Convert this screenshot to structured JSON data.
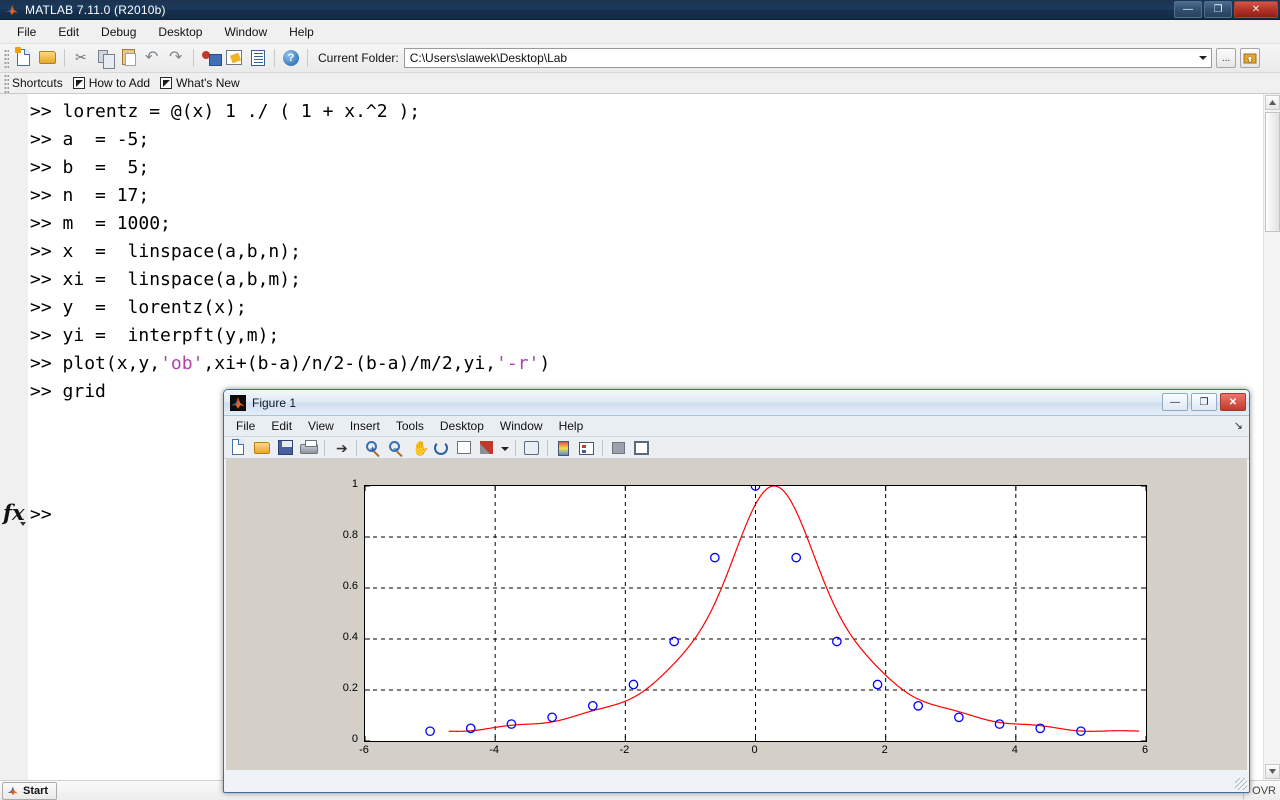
{
  "app": {
    "title": "MATLAB  7.11.0 (R2010b)",
    "logo_icon": "matlab-logo-icon"
  },
  "window_controls": {
    "minimize": "—",
    "maximize": "❐",
    "close": "✕"
  },
  "menu": {
    "items": [
      "File",
      "Edit",
      "Debug",
      "Desktop",
      "Window",
      "Help"
    ]
  },
  "toolbar": {
    "icons": [
      "new-script-icon",
      "open-file-icon",
      "cut-icon",
      "copy-icon",
      "paste-icon",
      "undo-icon",
      "redo-icon",
      "simulink-icon",
      "guide-icon",
      "profiler-icon",
      "help-icon"
    ],
    "current_folder_label": "Current Folder:",
    "current_folder_value": "C:\\Users\\slawek\\Desktop\\Lab",
    "browse_button_label": "...",
    "up_folder_icon": "folder-up-icon"
  },
  "shortcuts_bar": {
    "shortcuts_label": "Shortcuts",
    "how_to_add_label": "How to Add",
    "whats_new_label": "What's New"
  },
  "command_window": {
    "lines": [
      {
        "prompt": ">> ",
        "segments": [
          {
            "text": "lorentz = @(x) 1 ./ ( 1 + x.^2 );",
            "kind": "plain"
          }
        ]
      },
      {
        "prompt": ">> ",
        "segments": [
          {
            "text": "a  = -5;",
            "kind": "plain"
          }
        ]
      },
      {
        "prompt": ">> ",
        "segments": [
          {
            "text": "b  =  5;",
            "kind": "plain"
          }
        ]
      },
      {
        "prompt": ">> ",
        "segments": [
          {
            "text": "n  = 17;",
            "kind": "plain"
          }
        ]
      },
      {
        "prompt": ">> ",
        "segments": [
          {
            "text": "m  = 1000;",
            "kind": "plain"
          }
        ]
      },
      {
        "prompt": ">> ",
        "segments": [
          {
            "text": "x  =  linspace(a,b,n);",
            "kind": "plain"
          }
        ]
      },
      {
        "prompt": ">> ",
        "segments": [
          {
            "text": "xi =  linspace(a,b,m);",
            "kind": "plain"
          }
        ]
      },
      {
        "prompt": ">> ",
        "segments": [
          {
            "text": "y  =  lorentz(x);",
            "kind": "plain"
          }
        ]
      },
      {
        "prompt": ">> ",
        "segments": [
          {
            "text": "yi =  interpft(y,m);",
            "kind": "plain"
          }
        ]
      },
      {
        "prompt": ">> ",
        "segments": [
          {
            "text": "plot(x,y,",
            "kind": "plain"
          },
          {
            "text": "'ob'",
            "kind": "string"
          },
          {
            "text": ",xi+(b-a)/n/2-(b-a)/m/2,yi,",
            "kind": "plain"
          },
          {
            "text": "'-r'",
            "kind": "string"
          },
          {
            "text": ")",
            "kind": "plain"
          }
        ]
      },
      {
        "prompt": ">> ",
        "segments": [
          {
            "text": "grid",
            "kind": "plain"
          }
        ]
      }
    ],
    "active_prompt": ">>",
    "fx_label": "fx"
  },
  "status_bar": {
    "start_label": "Start",
    "start_icon": "matlab-logo-icon",
    "overwrite_label": "OVR"
  },
  "figure": {
    "title": "Figure 1",
    "logo_icon": "matlab-logo-icon",
    "window_controls": {
      "minimize": "—",
      "maximize": "❐",
      "close": "✕"
    },
    "menu": {
      "items": [
        "File",
        "Edit",
        "View",
        "Insert",
        "Tools",
        "Desktop",
        "Window",
        "Help"
      ]
    },
    "menu_expand_icon": "expand-arrow-icon",
    "toolbar_icons": [
      "new-figure-icon",
      "open-figure-icon",
      "save-figure-icon",
      "print-figure-icon",
      "pointer-icon",
      "zoom-in-icon",
      "zoom-out-icon",
      "pan-icon",
      "rotate-3d-icon",
      "data-cursor-icon",
      "brush-icon",
      "brush-dropdown-icon",
      "link-plot-icon",
      "colorbar-icon",
      "legend-icon",
      "hide-plot-tools-icon",
      "show-plot-tools-icon"
    ]
  },
  "chart_data": {
    "type": "scatter",
    "title": "",
    "xlabel": "",
    "ylabel": "",
    "xlim": [
      -6,
      6
    ],
    "ylim": [
      0,
      1
    ],
    "xticks": [
      -6,
      -4,
      -2,
      0,
      2,
      4,
      6
    ],
    "yticks": [
      0,
      0.2,
      0.4,
      0.6,
      0.8,
      1
    ],
    "grid": true,
    "legend": "none",
    "colors": {
      "markers": "#0000ff",
      "line": "#ff0000",
      "axes": "#000000",
      "figure_bg": "#d4d0c8",
      "axes_bg": "#ffffff"
    },
    "series": [
      {
        "name": "sample points (x, y) marker 'ob'",
        "style": "markers",
        "marker": "circle-open",
        "color": "#0000ff",
        "x": [
          -5,
          -4.375,
          -3.75,
          -3.125,
          -2.5,
          -1.875,
          -1.25,
          -0.625,
          0,
          0.625,
          1.25,
          1.875,
          2.5,
          3.125,
          3.75,
          4.375,
          5
        ],
        "y": [
          0.0385,
          0.0496,
          0.0664,
          0.0929,
          0.1379,
          0.2215,
          0.3902,
          0.7191,
          1.0,
          0.7191,
          0.3902,
          0.2215,
          0.1379,
          0.0929,
          0.0664,
          0.0496,
          0.0385
        ]
      },
      {
        "name": "interpft interpolation (xi shifted, yi) line '-r'",
        "style": "line",
        "color": "#ff0000",
        "x_range": [
          -4.7,
          5.3
        ],
        "description": "Fourier interpolation of the Lorentzian 1/(1+x^2) sampled at 17 points, evaluated at 1000 points shifted by (b-a)/n/2-(b-a)/m/2",
        "peak": {
          "x": 0.0,
          "y": 1.0
        }
      }
    ]
  }
}
